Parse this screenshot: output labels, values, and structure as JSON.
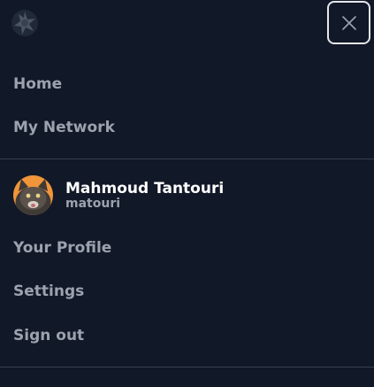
{
  "menu": {
    "logo_icon": "star-logo-icon",
    "close_icon": "close-icon",
    "nav_items": [
      {
        "label": "Home"
      },
      {
        "label": "My Network"
      }
    ],
    "user": {
      "name": "Mahmoud Tantouri",
      "handle": "matouri",
      "avatar": "cat-avatar"
    },
    "account_items": [
      {
        "label": "Your Profile"
      },
      {
        "label": "Settings"
      },
      {
        "label": "Sign out"
      }
    ]
  },
  "colors": {
    "background": "#111827",
    "text_muted": "#9ca3af",
    "text_primary": "#ffffff",
    "divider": "#374151",
    "close_border": "#e5e7eb"
  }
}
